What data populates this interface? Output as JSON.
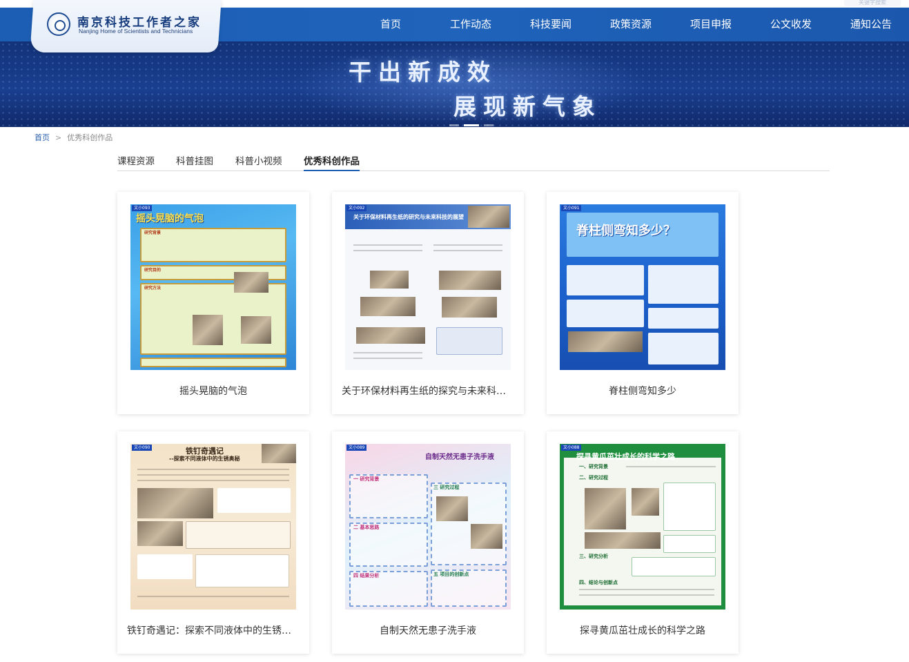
{
  "header": {
    "login_text": "关键字搜索",
    "logo_cn": "南京科技工作者之家",
    "logo_en": "Nanjing Home of Scientists and Technicians",
    "nav": [
      {
        "label": "首页"
      },
      {
        "label": "工作动态"
      },
      {
        "label": "科技要闻"
      },
      {
        "label": "政策资源"
      },
      {
        "label": "项目申报"
      },
      {
        "label": "公文收发"
      },
      {
        "label": "通知公告"
      }
    ],
    "slogan_line1": "干出新成效",
    "slogan_line2": "展现新气象"
  },
  "breadcrumb": {
    "home": "首页",
    "separator": ">",
    "current": "优秀科创作品"
  },
  "tabs": [
    {
      "label": "课程资源"
    },
    {
      "label": "科普挂图"
    },
    {
      "label": "科普小视频"
    },
    {
      "label": "优秀科创作品",
      "active": true
    }
  ],
  "cards": [
    {
      "title": "摇头晃脑的气泡",
      "poster_tag": "文小093",
      "poster_heading": "摇头晃脑的气泡",
      "poster_sections": [
        "研究背景",
        "研究目的",
        "研究方法"
      ]
    },
    {
      "title": "关于环保材料再生纸的探究与未来科技的展望",
      "poster_tag": "文小092",
      "poster_heading": "关于环保材料再生纸的研究与未来科技的展望"
    },
    {
      "title": "脊柱侧弯知多少",
      "poster_tag": "文小091",
      "poster_heading": "脊柱侧弯知多少？"
    },
    {
      "title": "铁钉奇遇记：探索不同液体中的生锈奥秘",
      "poster_tag": "文小090",
      "poster_heading": "铁钉奇遇记",
      "poster_subheading": "--探索不同液体中的生锈奥秘"
    },
    {
      "title": "自制天然无患子洗手液",
      "poster_tag": "文小089",
      "poster_heading": "自制天然无患子洗手液",
      "poster_sections": [
        "一 研究背景",
        "二 基本思路",
        "三 研究过程",
        "四 结果分析",
        "五 项目的创新点"
      ]
    },
    {
      "title": "探寻黄瓜茁壮成长的科学之路",
      "poster_tag": "文小088",
      "poster_heading": "探寻黄瓜茁壮成长的科学之路",
      "poster_sections": [
        "一、研究背景",
        "二、研究过程",
        "三、研究分析",
        "四、结论与创新点"
      ]
    }
  ],
  "colors": {
    "nav_bg": "#1d5eb5",
    "tab_active_underline": "#1d5eb5",
    "breadcrumb_home": "#2a5fae"
  }
}
